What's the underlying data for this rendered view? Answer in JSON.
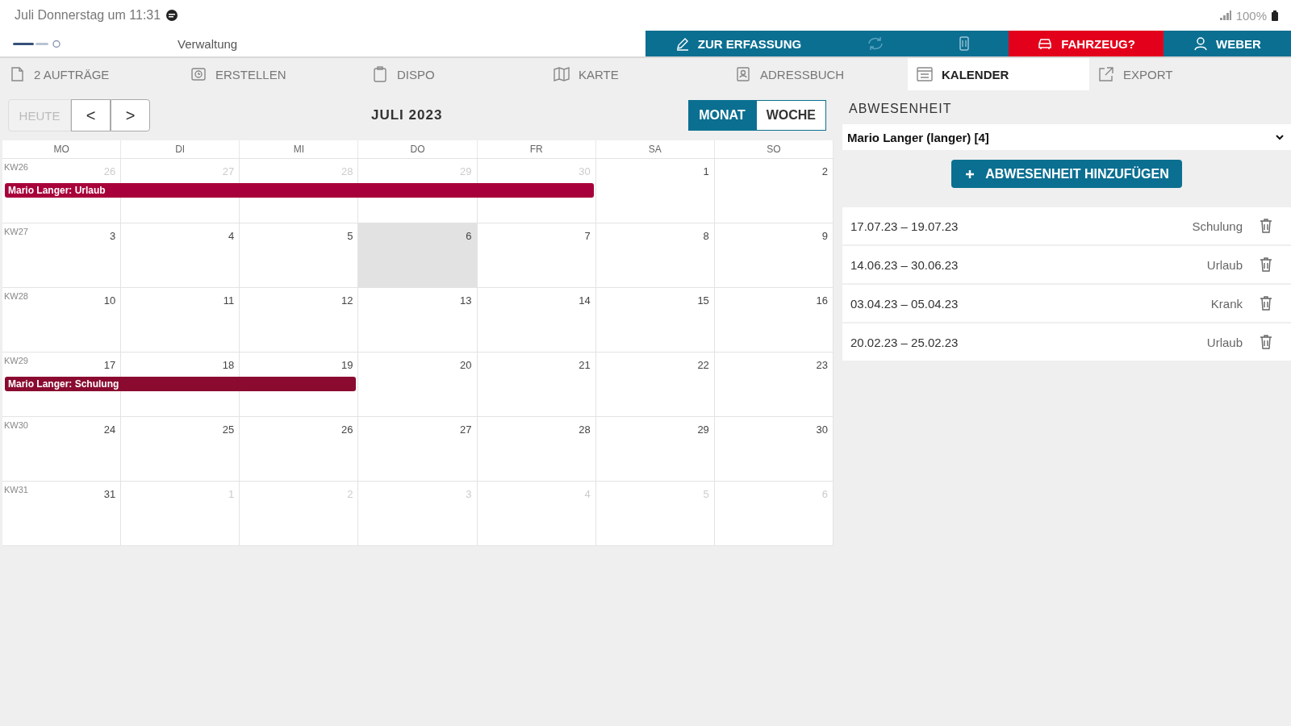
{
  "status_bar": {
    "time": "Juli Donnerstag um 11:31",
    "battery": "100%"
  },
  "header": {
    "section": "Verwaltung",
    "buttons": [
      {
        "kind": "edit",
        "label": "ZUR ERFASSUNG",
        "alert": false
      },
      {
        "kind": "sync",
        "alert": false
      },
      {
        "kind": "device",
        "alert": false
      },
      {
        "kind": "car",
        "label": "FAHRZEUG?",
        "alert": true
      },
      {
        "kind": "user",
        "label": "WEBER",
        "alert": false
      }
    ]
  },
  "tabs": [
    {
      "label": "2 AUFTRÄGE",
      "selected": false
    },
    {
      "label": "ERSTELLEN",
      "selected": false
    },
    {
      "label": "DISPO",
      "selected": false
    },
    {
      "label": "KARTE",
      "selected": false
    },
    {
      "label": "ADRESSBUCH",
      "selected": false
    },
    {
      "label": "KALENDER",
      "selected": true
    },
    {
      "label": "EXPORT",
      "selected": false
    }
  ],
  "calendar": {
    "today_button": {
      "label": "HEUTE",
      "disabled": true
    },
    "prev": "<",
    "next": ">",
    "title": "JULI 2023",
    "views": [
      {
        "label": "MONAT",
        "selected": true
      },
      {
        "label": "WOCHE",
        "selected": false
      }
    ],
    "weekdays": [
      "MO",
      "DI",
      "MI",
      "DO",
      "FR",
      "SA",
      "SO"
    ],
    "weeks": [
      {
        "kw": "KW26",
        "days": [
          {
            "day": "26",
            "muted": true,
            "today": false,
            "absent": true
          },
          {
            "day": "27",
            "muted": true,
            "today": false,
            "absent": true
          },
          {
            "day": "28",
            "muted": true,
            "today": false,
            "absent": true
          },
          {
            "day": "29",
            "muted": true,
            "today": false,
            "absent": true
          },
          {
            "day": "30",
            "muted": true,
            "today": false,
            "absent": true
          },
          {
            "day": "1",
            "muted": false,
            "today": false,
            "absent": false
          },
          {
            "day": "2",
            "muted": false,
            "today": false,
            "absent": false
          }
        ],
        "events": [
          {
            "label": "Mario Langer: Urlaub",
            "color": "#a8003a"
          }
        ]
      },
      {
        "kw": "KW27",
        "days": [
          {
            "day": "3",
            "muted": false,
            "today": false,
            "absent": false
          },
          {
            "day": "4",
            "muted": false,
            "today": false,
            "absent": false
          },
          {
            "day": "5",
            "muted": false,
            "today": false,
            "absent": false
          },
          {
            "day": "6",
            "muted": false,
            "today": true,
            "absent": false
          },
          {
            "day": "7",
            "muted": false,
            "today": false,
            "absent": false
          },
          {
            "day": "8",
            "muted": false,
            "today": false,
            "absent": false
          },
          {
            "day": "9",
            "muted": false,
            "today": false,
            "absent": false
          }
        ]
      },
      {
        "kw": "KW28",
        "days": [
          {
            "day": "10",
            "muted": false,
            "today": false,
            "absent": false
          },
          {
            "day": "11",
            "muted": false,
            "today": false,
            "absent": false
          },
          {
            "day": "12",
            "muted": false,
            "today": false,
            "absent": false
          },
          {
            "day": "13",
            "muted": false,
            "today": false,
            "absent": false
          },
          {
            "day": "14",
            "muted": false,
            "today": false,
            "absent": false
          },
          {
            "day": "15",
            "muted": false,
            "today": false,
            "absent": false
          },
          {
            "day": "16",
            "muted": false,
            "today": false,
            "absent": false
          }
        ]
      },
      {
        "kw": "KW29",
        "days": [
          {
            "day": "17",
            "muted": false,
            "today": false,
            "absent": true
          },
          {
            "day": "18",
            "muted": false,
            "today": false,
            "absent": true
          },
          {
            "day": "19",
            "muted": false,
            "today": false,
            "absent": true
          },
          {
            "day": "20",
            "muted": false,
            "today": false,
            "absent": false
          },
          {
            "day": "21",
            "muted": false,
            "today": false,
            "absent": false
          },
          {
            "day": "22",
            "muted": false,
            "today": false,
            "absent": false
          },
          {
            "day": "23",
            "muted": false,
            "today": false,
            "absent": false
          }
        ],
        "events": [
          {
            "label": "Mario Langer: Schulung",
            "color": "#8a0a30"
          }
        ]
      },
      {
        "kw": "KW30",
        "days": [
          {
            "day": "24",
            "muted": false,
            "today": false,
            "absent": false
          },
          {
            "day": "25",
            "muted": false,
            "today": false,
            "absent": false
          },
          {
            "day": "26",
            "muted": false,
            "today": false,
            "absent": false
          },
          {
            "day": "27",
            "muted": false,
            "today": false,
            "absent": false
          },
          {
            "day": "28",
            "muted": false,
            "today": false,
            "absent": false
          },
          {
            "day": "29",
            "muted": false,
            "today": false,
            "absent": false
          },
          {
            "day": "30",
            "muted": false,
            "today": false,
            "absent": false
          }
        ]
      },
      {
        "kw": "KW31",
        "days": [
          {
            "day": "31",
            "muted": false,
            "today": false,
            "absent": false
          },
          {
            "day": "1",
            "muted": true,
            "today": false,
            "absent": false
          },
          {
            "day": "2",
            "muted": true,
            "today": false,
            "absent": false
          },
          {
            "day": "3",
            "muted": true,
            "today": false,
            "absent": false
          },
          {
            "day": "4",
            "muted": true,
            "today": false,
            "absent": false
          },
          {
            "day": "5",
            "muted": true,
            "today": false,
            "absent": false
          },
          {
            "day": "6",
            "muted": true,
            "today": false,
            "absent": false
          }
        ]
      }
    ]
  },
  "absence": {
    "title": "ABWESENHEIT",
    "person": "Mario Langer (langer) [4]",
    "add_button": "ABWESENHEIT HINZUFÜGEN",
    "entries": [
      {
        "range": "17.07.23 – 19.07.23",
        "type": "Schulung"
      },
      {
        "range": "14.06.23 – 30.06.23",
        "type": "Urlaub"
      },
      {
        "range": "03.04.23 – 05.04.23",
        "type": "Krank"
      },
      {
        "range": "20.02.23 – 25.02.23",
        "type": "Urlaub"
      }
    ]
  }
}
